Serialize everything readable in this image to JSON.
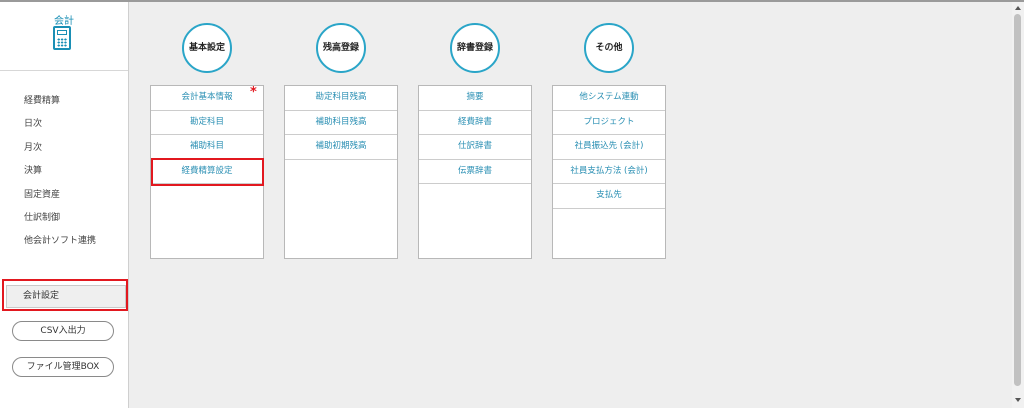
{
  "sidebar": {
    "title": "会計",
    "icon": "calculator-icon",
    "menu": [
      "経費精算",
      "日次",
      "月次",
      "決算",
      "固定資産",
      "仕訳制御",
      "他会計ソフト連携"
    ],
    "setting_button": "会計設定",
    "csv_button": "CSV入出力",
    "file_button": "ファイル管理BOX"
  },
  "columns": [
    {
      "title": "基本設定",
      "items": [
        "会計基本情報",
        "勘定科目",
        "補助科目",
        "経費精算設定"
      ]
    },
    {
      "title": "残高登録",
      "items": [
        "勘定科目残高",
        "補助科目残高",
        "補助初期残高"
      ]
    },
    {
      "title": "辞書登録",
      "items": [
        "摘要",
        "経費辞書",
        "仕訳辞書",
        "伝票辞書"
      ]
    },
    {
      "title": "その他",
      "items": [
        "他システム連動",
        "プロジェクト",
        "社員振込先 (会計)",
        "社員支払方法 (会計)",
        "支払先"
      ]
    }
  ],
  "colors": {
    "accent": "#2aa5c8",
    "link": "#2a8fb3",
    "highlight": "#e2181f",
    "background": "#eeeeee"
  }
}
